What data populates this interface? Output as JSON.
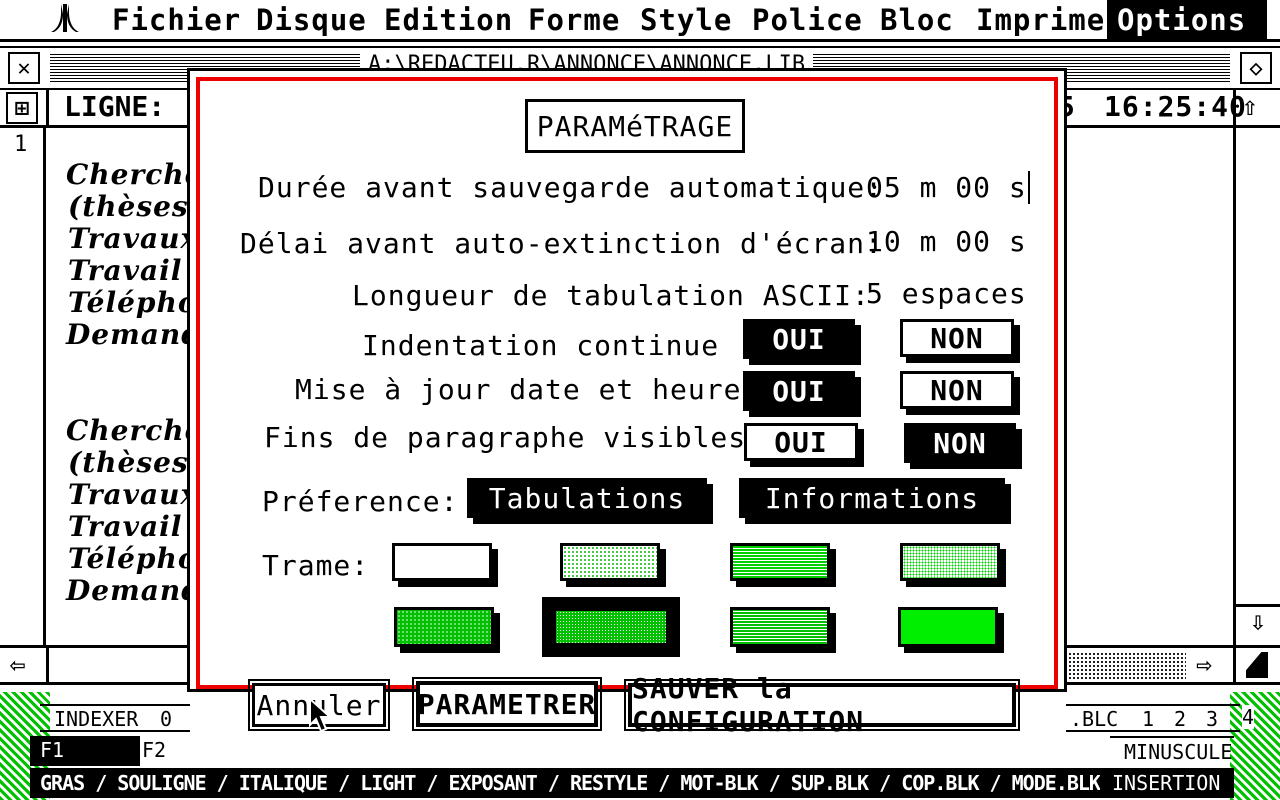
{
  "menubar": {
    "logo": "Atari",
    "items": [
      "Fichier",
      "Disque",
      "Edition",
      "Forme",
      "Style",
      "Police",
      "Bloc",
      "Imprime",
      "Options"
    ],
    "active": "Options"
  },
  "window": {
    "path": "A:\\REDACTEU.R\\ANNONCE\\ANNONCE.LIB",
    "ligne_label": "LIGNE:",
    "clock": "16:25:40",
    "clock_prefix": "5",
    "line_number": "1",
    "doc_lines_a": [
      "Cherche",
      "(thèses,",
      "Travaux",
      "Travail",
      "Téléphon",
      "Demander"
    ],
    "doc_lines_b": [
      "Cherche",
      "(thèses,",
      "Travaux",
      "Travail",
      "Téléphon",
      "Demander"
    ]
  },
  "dialog": {
    "title": "PARAMéTRAGE",
    "autosave_label": "Durée avant sauvegarde automatique:",
    "autosave_value": "05 m 00 s",
    "screen_off_label": "Délai avant auto-extinction d'écran:",
    "screen_off_value": "10 m 00 s",
    "tab_length_label": "Longueur de tabulation ASCII:",
    "tab_length_value": "5 espaces",
    "indent_label": "Indentation continue :",
    "datetime_label": "Mise à jour date et heure:",
    "paragraph_label": "Fins de paragraphe visibles:",
    "yes": "OUI",
    "no": "NON",
    "preference_label": "Préference:",
    "pref_tabs": "Tabulations",
    "pref_info": "Informations",
    "trame_label": "Trame:",
    "cancel": "Annuler",
    "apply": "PARAMETRER",
    "save": "SAUVER la CONFIGURATION",
    "selected": {
      "indent": "OUI",
      "datetime": "OUI",
      "paragraph": "NON",
      "trame": 6
    }
  },
  "fkeys": {
    "row1": [
      "INDEXER",
      "0"
    ],
    "row1_right": [
      ".BLC",
      "1",
      "2",
      "3",
      "4"
    ],
    "f1": "F1",
    "f2": "F2",
    "minuscule": "MINUSCULE",
    "row3": "GRAS / SOULIGNE / ITALIQUE / LIGHT / EXPOSANT / RESTYLE / MOT-BLK / SUP.BLK / COP.BLK / MODE.BLK",
    "insertion": "INSERTION"
  }
}
